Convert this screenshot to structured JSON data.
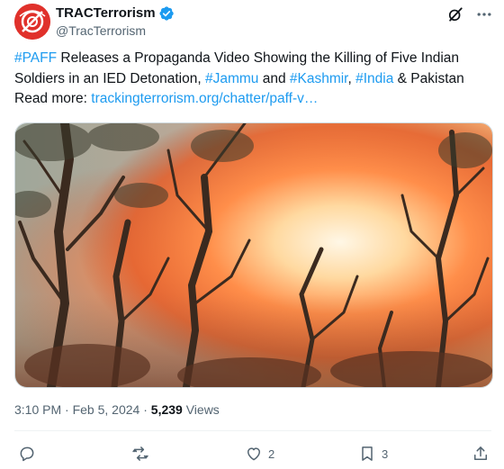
{
  "author": {
    "display_name": "TRACTerrorism",
    "handle": "@TracTerrorism",
    "verified": true,
    "avatar_icon": "trac-logo",
    "brand_color": "#e0312b"
  },
  "tweet": {
    "hashtag_paff": "#PAFF",
    "text_1": " Releases a Propaganda Video Showing the Killing of Five Indian Soldiers in an IED Detonation, ",
    "hashtag_jammu": "#Jammu",
    "text_2": " and ",
    "hashtag_kashmir": "#Kashmir",
    "text_3": ", ",
    "hashtag_india": "#India",
    "text_4": " & Pakistan",
    "read_more": "Read more: ",
    "link": "trackingterrorism.org/chatter/paff-v…"
  },
  "meta": {
    "time": "3:10 PM",
    "sep": " · ",
    "date": "Feb 5, 2024",
    "sep2": " · ",
    "views_count": "5,239",
    "views_label": " Views"
  },
  "actions": {
    "reply_icon": "reply-icon",
    "repost_icon": "repost-icon",
    "like_icon": "heart-icon",
    "like_count": "2",
    "bookmark_icon": "bookmark-icon",
    "bookmark_count": "3",
    "share_icon": "share-icon"
  },
  "colors": {
    "link": "#1d9bf0",
    "secondary_text": "#536471",
    "verified": "#1d9bf0"
  }
}
